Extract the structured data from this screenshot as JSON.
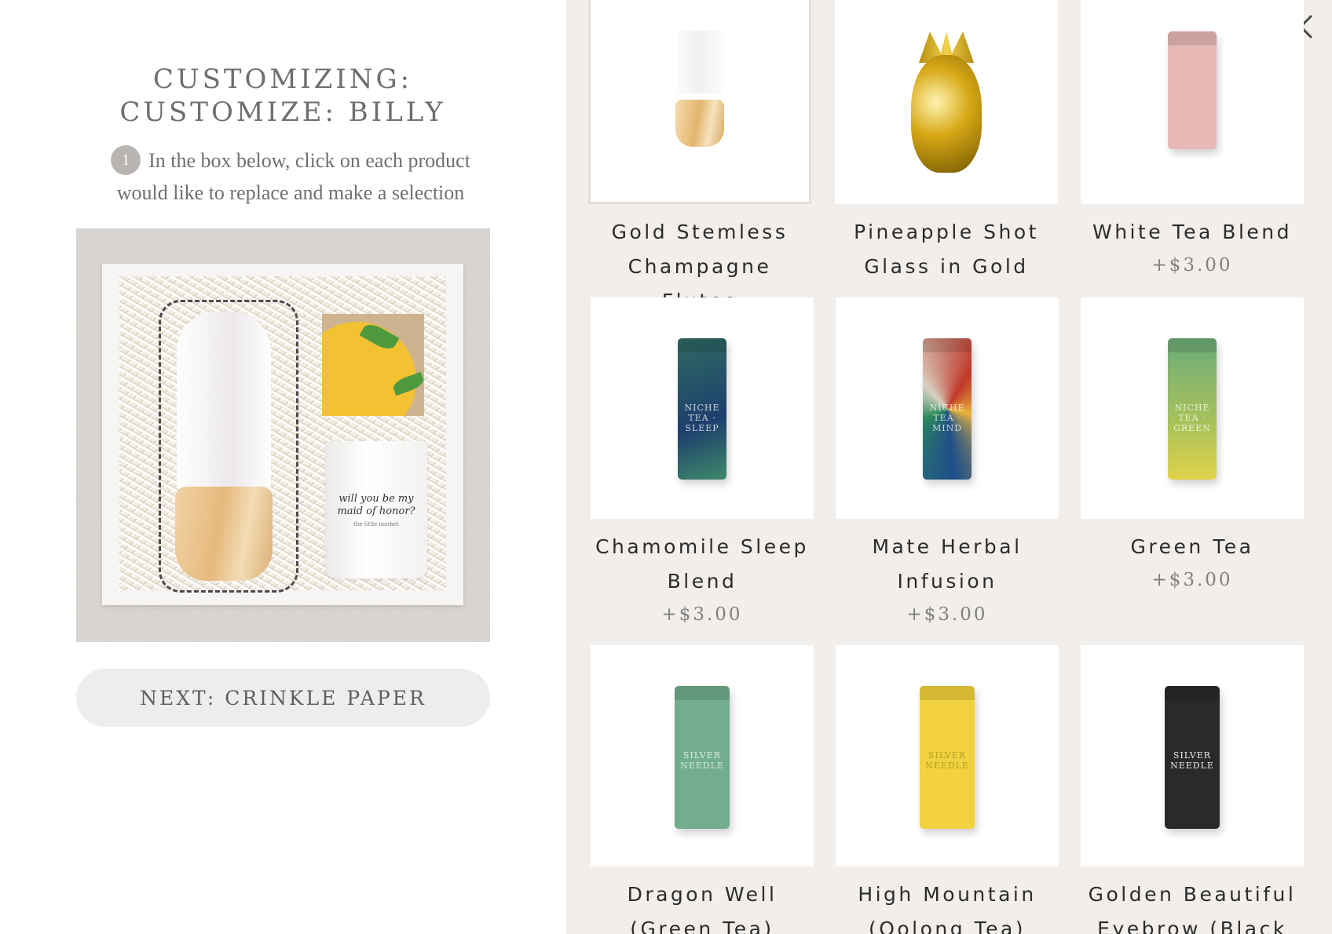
{
  "left": {
    "title": "CUSTOMIZING: CUSTOMIZE: BILLY",
    "step_number": "1",
    "instruction": "In the box below, click on each product would like to replace and make a selection",
    "candle_text_line1": "will you be my",
    "candle_text_line2": "maid of honor?",
    "candle_brand": "the little market",
    "next_button_label": "NEXT: CRINKLE PAPER"
  },
  "products": [
    {
      "name": "Gold Stemless Champagne Flutes",
      "price": "",
      "selected": true
    },
    {
      "name": "Pineapple Shot Glass in Gold",
      "price": ""
    },
    {
      "name": "White Tea Blend",
      "price": "+$3.00",
      "tin_color": "#e8b9b5"
    },
    {
      "name": "Chamomile Sleep Blend",
      "price": "+$3.00",
      "tin_color": "#2f6a63",
      "tin_label": "NICHE TEA · SLEEP"
    },
    {
      "name": "Mate Herbal Infusion",
      "price": "+$3.00",
      "tin_color": "#c0392b",
      "tin_label": "NICHE TEA · MIND"
    },
    {
      "name": "Green Tea",
      "price": "+$3.00",
      "tin_color": "#6cab7a",
      "tin_label": "NICHE TEA · GREEN"
    },
    {
      "name": "Dragon Well (Green Tea)",
      "price": "",
      "tin_color": "#72ad8d",
      "tin_label": "SILVER NEEDLE"
    },
    {
      "name": "High Mountain (Oolong Tea)",
      "price": "",
      "tin_color": "#f2d23e",
      "tin_label": "SILVER NEEDLE"
    },
    {
      "name": "Golden Beautiful Eyebrow (Black",
      "price": "",
      "tin_color": "#2a2a2a",
      "tin_label": "SILVER NEEDLE"
    }
  ],
  "colors": {
    "left_bg": "#ffffff",
    "right_bg": "#f1eeeb",
    "button_bg": "#efedeb",
    "accent_text": "#2c2c2c"
  },
  "icons": {
    "close": "close-icon",
    "step": "step-number-badge"
  }
}
